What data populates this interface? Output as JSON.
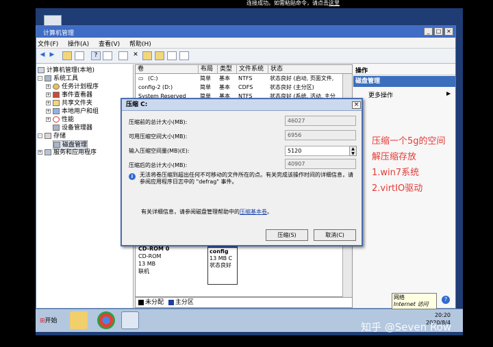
{
  "connection_message": "连接成功。如需粘贴命令，请点击",
  "connection_link": "这里",
  "window": {
    "title": "计算机管理",
    "controls": [
      "_",
      "□",
      "×"
    ]
  },
  "menu": [
    "文件(F)",
    "操作(A)",
    "查看(V)",
    "帮助(H)"
  ],
  "tree": [
    {
      "label": "计算机管理(本地)",
      "level": 0,
      "exp": ""
    },
    {
      "label": "系统工具",
      "level": 1,
      "exp": "-"
    },
    {
      "label": "任务计划程序",
      "level": 2,
      "exp": "+"
    },
    {
      "label": "事件查看器",
      "level": 2,
      "exp": "+"
    },
    {
      "label": "共享文件夹",
      "level": 2,
      "exp": "+"
    },
    {
      "label": "本地用户和组",
      "level": 2,
      "exp": "+"
    },
    {
      "label": "性能",
      "level": 2,
      "exp": "+"
    },
    {
      "label": "设备管理器",
      "level": 2,
      "exp": ""
    },
    {
      "label": "存储",
      "level": 1,
      "exp": "-"
    },
    {
      "label": "磁盘管理",
      "level": 2,
      "exp": ""
    },
    {
      "label": "服务和应用程序",
      "level": 1,
      "exp": "+"
    }
  ],
  "columns": [
    "卷",
    "布局",
    "类型",
    "文件系统",
    "状态"
  ],
  "volumes": [
    {
      "vol": "(C:)",
      "layout": "简单",
      "type": "基本",
      "fs": "NTFS",
      "status": "状态良好 (启动, 页面文件,"
    },
    {
      "vol": "config-2 (D:)",
      "layout": "简单",
      "type": "基本",
      "fs": "CDFS",
      "status": "状态良好 (主分区)"
    },
    {
      "vol": "System Reserved",
      "layout": "简单",
      "type": "基本",
      "fs": "NTFS",
      "status": "状态良好 (系统, 活动, 主分"
    }
  ],
  "disk_area": {
    "cdrom_title": "CD-ROM 0",
    "cdrom_type": "CD-ROM",
    "cdrom_size": "13 MB",
    "cdrom_state": "联机",
    "part_name": "config",
    "part_size": "13 MB C",
    "part_status": "状态良好"
  },
  "legend": {
    "unalloc": "未分配",
    "primary": "主分区"
  },
  "actions": {
    "title": "操作",
    "section": "磁盘管理",
    "more": "更多操作"
  },
  "note": [
    "压缩一个5g的空间",
    "解压缩存放",
    "1.win7系统",
    "2.virtIO驱动"
  ],
  "dialog": {
    "title": "压缩 C:",
    "close": "×",
    "fields": [
      {
        "label": "压缩前的总计大小(MB):",
        "value": "46027"
      },
      {
        "label": "可用压缩空间大小(MB):",
        "value": "6956"
      },
      {
        "label": "输入压缩空间量(MB)(E):",
        "value": "5120"
      },
      {
        "label": "压缩后的总计大小(MB):",
        "value": "40907"
      }
    ],
    "info": "无法将卷压缩到超出任何不可移动的文件所在的点。有关完成该操作时间的详细信息，请参阅应用程序日志中的 \"defrag\" 事件。",
    "help_prefix": "有关详细信息，请参阅磁盘管理帮助中的",
    "help_link": "压缩基本卷",
    "help_suffix": "。",
    "ok": "压缩(S)",
    "cancel": "取消(C)"
  },
  "taskbar": {
    "start": "开始",
    "time": "20:20",
    "date": "2020/8/4"
  },
  "net_tip": {
    "title": "网络",
    "sub": "Internet 访问"
  },
  "watermark": "知乎 @Seven Row",
  "colors": {
    "title_bar": "#3f6cc4",
    "note": "#e53935",
    "desktop": "#1f3d74"
  }
}
